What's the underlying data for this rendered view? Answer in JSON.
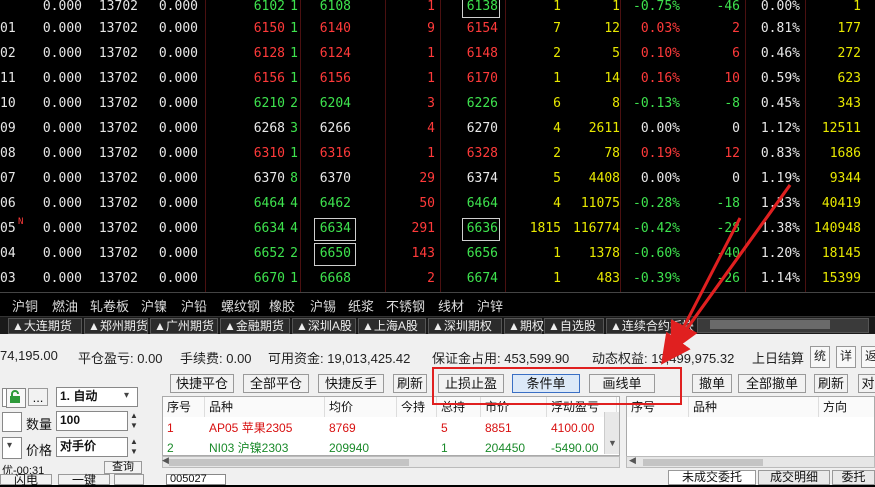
{
  "quote_rows": [
    {
      "code": "01",
      "c1": "0.000",
      "c2": "13702",
      "c3": "0.000",
      "buy": "6150",
      "bq": "1",
      "sell": "6140",
      "sq": "9",
      "last": "6154",
      "vol": "7",
      "v2": "12",
      "chg": "0.03%",
      "d": "2",
      "pct": "0.81%",
      "oi": "177"
    },
    {
      "code": "02",
      "c1": "0.000",
      "c2": "13702",
      "c3": "0.000",
      "buy": "6128",
      "bq": "1",
      "sell": "6124",
      "sq": "1",
      "last": "6148",
      "vol": "2",
      "v2": "5",
      "chg": "0.10%",
      "d": "6",
      "pct": "0.46%",
      "oi": "272"
    },
    {
      "code": "11",
      "c1": "0.000",
      "c2": "13702",
      "c3": "0.000",
      "buy": "6156",
      "bq": "1",
      "sell": "6156",
      "sq": "1",
      "last": "6170",
      "vol": "1",
      "v2": "14",
      "chg": "0.16%",
      "d": "10",
      "pct": "0.59%",
      "oi": "623"
    },
    {
      "code": "10",
      "c1": "0.000",
      "c2": "13702",
      "c3": "0.000",
      "buy": "6210",
      "bq": "2",
      "sell": "6204",
      "sq": "3",
      "last": "6226",
      "vol": "6",
      "v2": "8",
      "chg": "-0.13%",
      "d": "-8",
      "pct": "0.45%",
      "oi": "343"
    },
    {
      "code": "09",
      "c1": "0.000",
      "c2": "13702",
      "c3": "0.000",
      "buy": "6268",
      "bq": "3",
      "sell": "6266",
      "sq": "4",
      "last": "6270",
      "vol": "4",
      "v2": "2611",
      "chg": "0.00%",
      "d": "0",
      "pct": "1.12%",
      "oi": "12511"
    },
    {
      "code": "08",
      "c1": "0.000",
      "c2": "13702",
      "c3": "0.000",
      "buy": "6310",
      "bq": "1",
      "sell": "6316",
      "sq": "1",
      "last": "6328",
      "vol": "2",
      "v2": "78",
      "chg": "0.19%",
      "d": "12",
      "pct": "0.83%",
      "oi": "1686"
    },
    {
      "code": "07",
      "c1": "0.000",
      "c2": "13702",
      "c3": "0.000",
      "buy": "6370",
      "bq": "8",
      "sell": "6370",
      "sq": "29",
      "last": "6374",
      "vol": "5",
      "v2": "4408",
      "chg": "0.00%",
      "d": "0",
      "pct": "1.19%",
      "oi": "9344"
    },
    {
      "code": "06",
      "c1": "0.000",
      "c2": "13702",
      "c3": "0.000",
      "buy": "6464",
      "bq": "4",
      "sell": "6462",
      "sq": "50",
      "last": "6464",
      "vol": "4",
      "v2": "11075",
      "chg": "-0.28%",
      "d": "-18",
      "pct": "1.33%",
      "oi": "40419"
    },
    {
      "code": "05",
      "c1": "0.000",
      "c2": "13702",
      "c3": "0.000",
      "buy": "6634",
      "bq": "4",
      "sell": "6634",
      "sq": "291",
      "last": "6636",
      "vol": "1815",
      "v2": "116774",
      "chg": "-0.42%",
      "d": "-28",
      "pct": "1.38%",
      "oi": "140948"
    },
    {
      "code": "04",
      "c1": "0.000",
      "c2": "13702",
      "c3": "0.000",
      "buy": "6652",
      "bq": "2",
      "sell": "6650",
      "sq": "143",
      "last": "6656",
      "vol": "1",
      "v2": "1378",
      "chg": "-0.60%",
      "d": "-40",
      "pct": "1.20%",
      "oi": "18145"
    },
    {
      "code": "03",
      "c1": "0.000",
      "c2": "13702",
      "c3": "0.000",
      "buy": "6670",
      "bq": "1",
      "sell": "6668",
      "sq": "2",
      "last": "6674",
      "vol": "1",
      "v2": "483",
      "chg": "-0.39%",
      "d": "-26",
      "pct": "1.14%",
      "oi": "15399"
    }
  ],
  "top_partial_row": {
    "code": "",
    "c1": "0.000",
    "c2": "13702",
    "c3": "0.000",
    "buy": "6102",
    "bq": "1",
    "sell": "6108",
    "sq": "1",
    "last": "6138",
    "vol": "1",
    "v2": "1",
    "chg": "-0.75%",
    "d": "-46",
    "pct": "0.00%",
    "oi": "1"
  },
  "varieties": [
    "沪铜",
    "燃油",
    "轧卷板",
    "沪镍",
    "沪铅",
    "螺纹钢",
    "橡胶",
    "沪锡",
    "纸浆",
    "不锈钢",
    "线材",
    "沪锌"
  ],
  "market_tabs": [
    "▲大连期货",
    "▲郑州期货",
    "▲广州期货",
    "▲金融期货",
    "▲深圳A股",
    "▲上海A股",
    "▲深圳期权",
    "▲期权",
    "▲自选股",
    "▲连续合约板块"
  ],
  "status": {
    "balance": "74,195.00",
    "close_pnl": "平仓盈亏: 0.00",
    "fee": "手续费: 0.00",
    "available": "可用资金: 19,013,425.42",
    "margin": "保证金占用: 453,599.90",
    "equity": "动态权益: 19,499,975.32",
    "settle": "上日结算",
    "btn_stats": "统",
    "btn_detail": "详",
    "btn_back": "返"
  },
  "order_form": {
    "mode": "1. 自动",
    "qty_label": "数量",
    "qty": "100",
    "price_label": "价格",
    "price": "对手价",
    "query": "查询",
    "partial": "优-00:31",
    "btn_flash": "闪电",
    "btn_one": "一键",
    "dots": "...",
    "account": "005027"
  },
  "position_toolbar": [
    "快捷平仓",
    "全部平仓",
    "快捷反手",
    "刷新",
    "止损止盈",
    "条件单",
    "画线单"
  ],
  "position_table": {
    "headers": [
      "序号",
      "品种",
      "均价",
      "今持",
      "总持",
      "市价",
      "浮动盈亏"
    ],
    "rows": [
      {
        "no": "1",
        "name": "AP05 苹果2305",
        "avg": "8769",
        "today": "",
        "total": "5",
        "price": "8851",
        "pnl": "4100.00"
      },
      {
        "no": "2",
        "name": "NI03 沪镍2303",
        "avg": "209940",
        "today": "",
        "total": "1",
        "price": "204450",
        "pnl": "-5490.00"
      }
    ]
  },
  "order_toolbar": [
    "撤单",
    "全部撤单",
    "刷新",
    "对"
  ],
  "order_table": {
    "headers": [
      "序号",
      "品种",
      "方向"
    ]
  },
  "bottom_tabs": [
    "未成交委托",
    "成交明细",
    "委托"
  ],
  "colors": {
    "up": "#ff3a3a",
    "down": "#3ee34e",
    "neutral": "#e8e8e8",
    "volume": "#e8e800",
    "highlight": "#e02020"
  }
}
